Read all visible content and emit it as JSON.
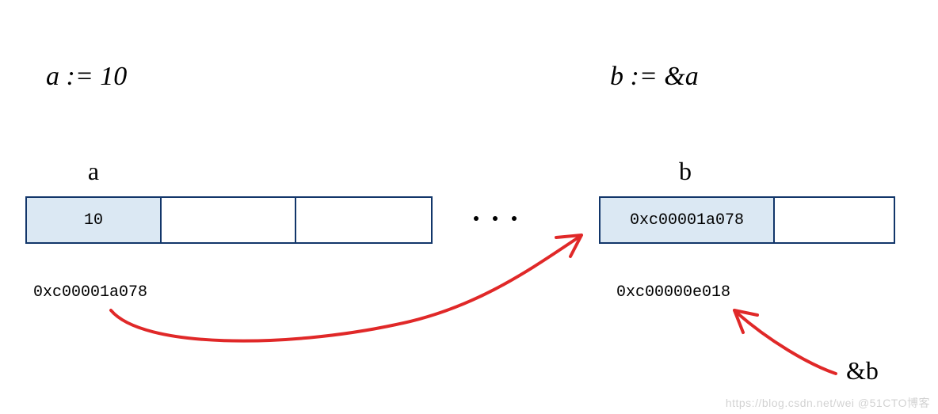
{
  "assign_a": "a := 10",
  "assign_b": "b := &a",
  "label_a": "a",
  "label_b": "b",
  "cell_a_value": "10",
  "cell_b_value": "0xc00001a078",
  "addr_a": "0xc00001a078",
  "addr_b": "0xc00000e018",
  "amp_b": "&b",
  "colors": {
    "cell_shaded": "#dbe8f3",
    "cell_border": "#12366a",
    "arrow": "#e02828"
  },
  "watermark": "https://blog.csdn.net/wei @51CTO博客"
}
